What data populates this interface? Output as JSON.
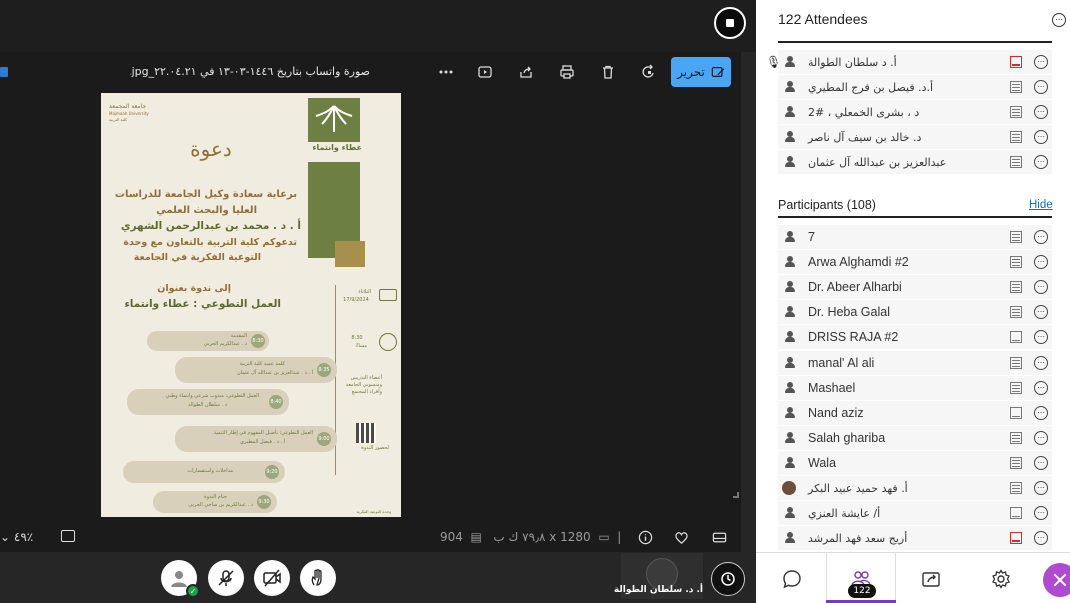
{
  "viewer": {
    "file_name": "صورة واتساب بتاريخ ١٤٤٦-٠٣-١٣ في ٢٢.٠٤.٢١_٦١٣٠a١٥f.jpg",
    "edit_label": "تحرير",
    "zoom_level": "٤٩٪",
    "dimensions": "904 x 1280",
    "file_size": "٧٩٫٨ ك ب"
  },
  "flyer": {
    "logo_text": "عطاء وانتماء",
    "title_word": "دعوة",
    "line1": "برعاية سعادة وكيل الجامعة للدراسات",
    "line2": "العليا والبحث العلمي",
    "line3": "أ . د . محمد بن عبدالرحمن الشهري",
    "line4": "تدعوكم كلية التربية بالتعاون مع وحدة",
    "line5": "التوعية الفكرية في الجامعة",
    "line6": "إلى ندوة بعنوان",
    "line7": "العمل التطوعي : عطاء وانتماء",
    "uni_name": "جامعة المجمعة",
    "uni_name_en": "Majmaah University",
    "uni_college": "كلية التربية",
    "date_day": "الثلاثاء",
    "date_value": "17/9/2024",
    "time_value": "8:30",
    "time_period": "مساءً",
    "audience_1": "أعضاء التدريس",
    "audience_2": "ومنسوبي الجامعة",
    "audience_3": "وأفراد المجتمع",
    "qr_label": "لحضور الندوة",
    "footer": "وحدة التوعية الفكرية",
    "agenda": [
      {
        "time": "8:30",
        "title": "المقدمة",
        "speaker": "د . عبدالكريم الحربي"
      },
      {
        "time": "8:35",
        "title": "كلمة عميد كلية التربية",
        "speaker": "أ . د . عبدالعزيز بن عبدالله آل عثمان"
      },
      {
        "time": "8:40",
        "title": "العمل التطوعي: مندوب شرعي وانتماء وطني",
        "speaker": "د . سلطان الطوالة"
      },
      {
        "time": "9:00",
        "title": "العمل التطوعي: تأصيل المفهوم في إطار التنمية",
        "speaker": "أ . د . فيصل المطيري"
      },
      {
        "time": "9:20",
        "title": "مداخلات واستفسارات",
        "speaker": ""
      },
      {
        "time": "9:30",
        "title": "ختام الندوة",
        "speaker": "د . عبدالكريم بن ساجي الحربي"
      }
    ]
  },
  "speaker": {
    "name": "أ. د. سلطان الطوالة"
  },
  "panel": {
    "title": "122 Attendees",
    "section_title": "Participants (108)",
    "hide_label": "Hide",
    "people_count": "122",
    "presenters": [
      {
        "name": "أ. د سلطان الطوالة",
        "mic": true,
        "screen": "red"
      },
      {
        "name": "أ.د. فيصل بن فرج المطيري",
        "mic": false,
        "screen": "normal"
      },
      {
        "name": "د ، بشرى الخمعلي ، #2",
        "mic": false,
        "screen": "normal"
      },
      {
        "name": "د. خالد بن سيف آل ناصر",
        "mic": false,
        "screen": "normal"
      },
      {
        "name": "عبدالعزيز بن عبدالله آل عثمان",
        "mic": false,
        "screen": "normal"
      }
    ],
    "participants": [
      {
        "name": "7",
        "rtl": false,
        "screen": "normal",
        "avatar": "person"
      },
      {
        "name": "Arwa Alghamdi #2",
        "rtl": false,
        "screen": "normal",
        "avatar": "person"
      },
      {
        "name": "Dr. Abeer Alharbi",
        "rtl": false,
        "screen": "normal",
        "avatar": "person"
      },
      {
        "name": "Dr. Heba Galal",
        "rtl": false,
        "screen": "normal",
        "avatar": "person"
      },
      {
        "name": "DRISS RAJA #2",
        "rtl": false,
        "screen": "light",
        "avatar": "person"
      },
      {
        "name": "manal' Al ali",
        "rtl": false,
        "screen": "normal",
        "avatar": "person"
      },
      {
        "name": "Mashael",
        "rtl": false,
        "screen": "normal",
        "avatar": "person"
      },
      {
        "name": "Nand aziz",
        "rtl": false,
        "screen": "light",
        "avatar": "person"
      },
      {
        "name": "Salah gharibа",
        "rtl": false,
        "screen": "normal",
        "avatar": "person"
      },
      {
        "name": "Wala",
        "rtl": false,
        "screen": "normal",
        "avatar": "person"
      },
      {
        "name": "أ. فهد حميد عبيد البكر",
        "rtl": true,
        "screen": "normal",
        "avatar": "photo"
      },
      {
        "name": "أ/ عايشة العنزي",
        "rtl": true,
        "screen": "light",
        "avatar": "person"
      },
      {
        "name": "أريج سعد فهد المرشد",
        "rtl": true,
        "screen": "red",
        "avatar": "person"
      }
    ]
  },
  "colors": {
    "accent_purple": "#7b3bb4",
    "edit_blue": "#4aa5f2",
    "link_blue": "#1670b8",
    "flyer_green": "#6d7f43"
  }
}
